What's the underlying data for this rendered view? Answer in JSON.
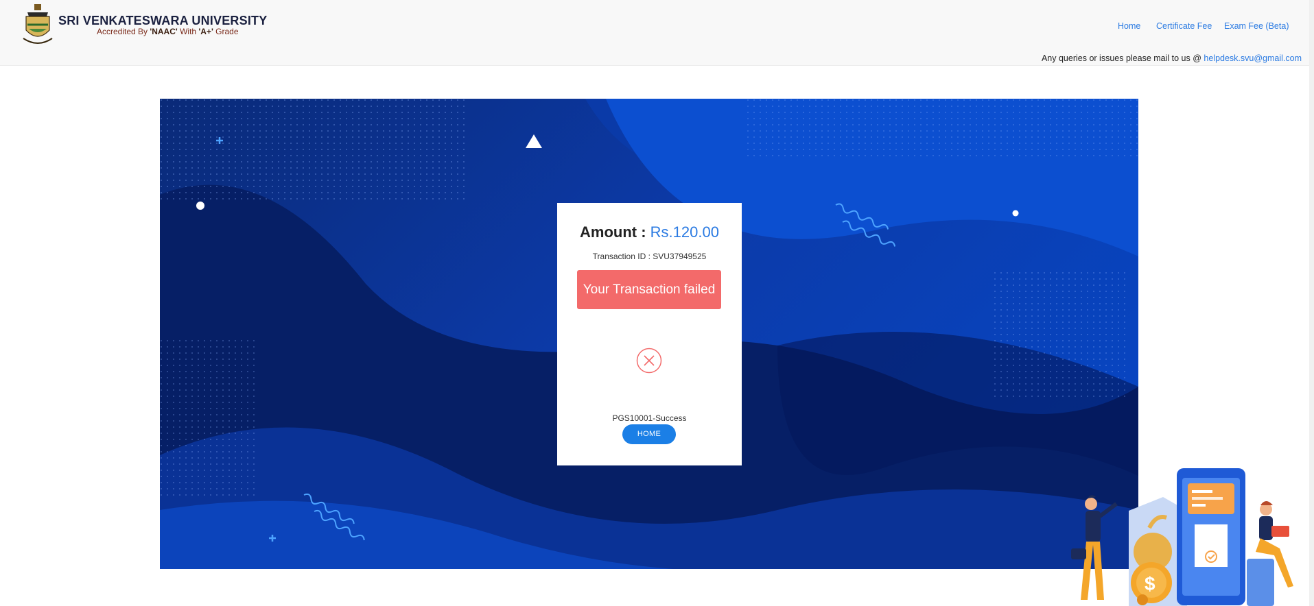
{
  "header": {
    "title": "SRI VENKATESWARA UNIVERSITY",
    "subtitle_prefix": "Accredited By ",
    "subtitle_naac": "'NAAC'",
    "subtitle_mid": " With ",
    "subtitle_grade": "'A+'",
    "subtitle_suffix": " Grade",
    "logo_icon": "university-crest-icon"
  },
  "nav": {
    "home": "Home",
    "certificate_fee": "Certificate Fee",
    "exam_fee": "Exam Fee (Beta)"
  },
  "queries": {
    "text": "Any queries or issues please mail to us @ ",
    "email": "helpdesk.svu@gmail.com"
  },
  "card": {
    "amount_label": "Amount : ",
    "amount_value": "Rs.120.00",
    "txn_label": "Transaction ID : ",
    "txn_id": "SVU37949525",
    "failure_message": "Your Transaction failed",
    "status_icon": "failure-x-icon",
    "status_code": "PGS10001-Success",
    "home_button": "HOME"
  },
  "colors": {
    "accent": "#2a7ae2",
    "fail": "#f36a6a",
    "button": "#1b7fe6",
    "hero_dark": "#0a2a78",
    "hero_light": "#0648c8"
  }
}
